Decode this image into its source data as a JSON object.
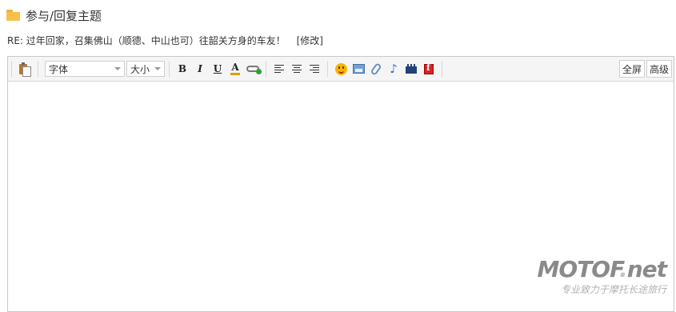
{
  "header": {
    "title": "参与/回复主题"
  },
  "subject": {
    "value": "RE: 过年回家，召集佛山（顺德、中山也可）往韶关方身的车友！",
    "edit_label": "[修改]"
  },
  "toolbar": {
    "font_select": "字体",
    "size_select": "大小",
    "bold_label": "B",
    "italic_label": "I",
    "underline_label": "U",
    "fontcolor_label": "A",
    "music_glyph": "♪",
    "fullscreen_label": "全屏",
    "advanced_label": "高级"
  },
  "watermark": {
    "logo_text": "MOTOF",
    "logo_dot": ".",
    "logo_suffix": "net",
    "slogan": "专业致力于摩托长途旅行"
  },
  "colors": {
    "folder": "#f7c04a",
    "toolbar_bg": "#f5f5f5",
    "border": "#c8c8c8",
    "fontcolor_bar": "#e39b00"
  }
}
